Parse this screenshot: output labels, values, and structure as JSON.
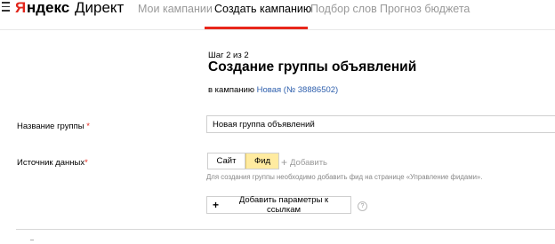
{
  "header": {
    "logo_ya": "Я",
    "logo_rest": "ндекс",
    "logo_product": "Директ",
    "nav": [
      {
        "label": "Мои кампании"
      },
      {
        "label": "Создать кампанию"
      },
      {
        "label": "Подбор слов"
      },
      {
        "label": "Прогноз бюджета"
      }
    ]
  },
  "form": {
    "step": "Шаг 2 из 2",
    "title": "Создание группы объявлений",
    "campaign_prefix": "в кампанию",
    "campaign_link": "Новая (№ 38886502)",
    "group_name_label": "Название группы",
    "group_name_value": "Новая группа объявлений",
    "source_label": "Источник данных",
    "required_mark": "*",
    "source_options": [
      "Сайт",
      "Фид"
    ],
    "source_selected": "Фид",
    "add_label": "Добавить",
    "hint": "Для создания группы необходимо добавить фид на странице «Управление фидами».",
    "params_button": "Добавить параметры к ссылкам",
    "help_mark": "?"
  },
  "colors": {
    "accent_red": "#e8271b",
    "link_blue": "#2e5fad",
    "selected_yellow": "#ffeba0"
  }
}
